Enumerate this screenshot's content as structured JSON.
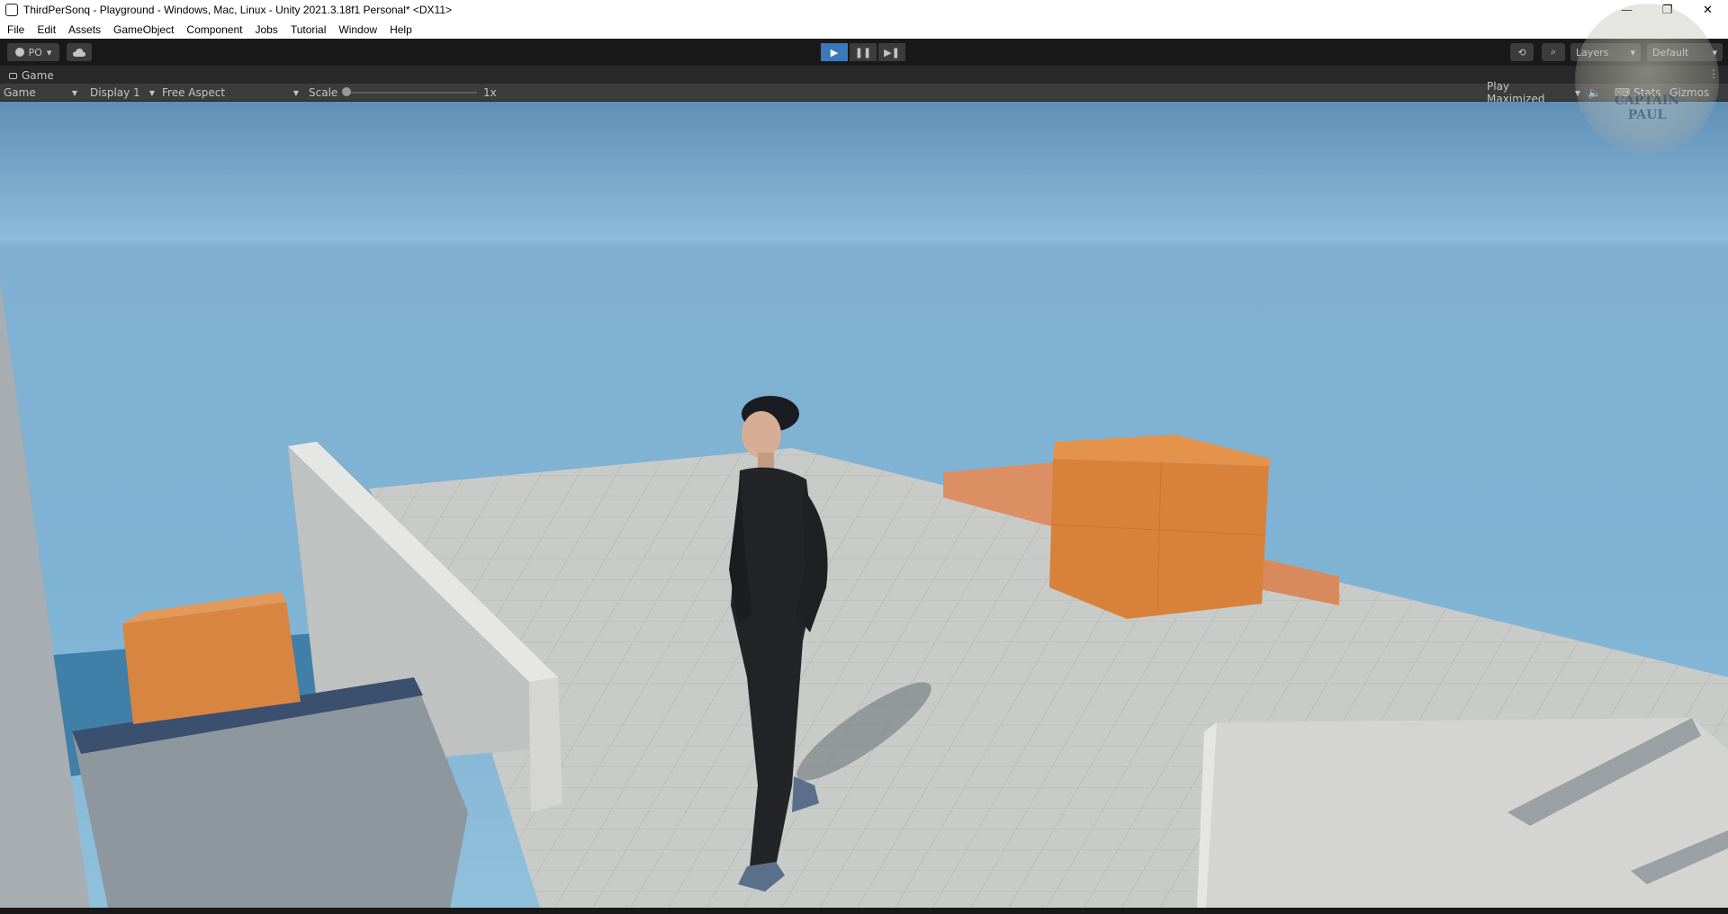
{
  "window": {
    "title": "ThirdPerSonq - Playground - Windows, Mac, Linux - Unity 2021.3.18f1 Personal* <DX11>",
    "minimize_glyph": "—",
    "maximize_glyph": "❐",
    "close_glyph": "✕"
  },
  "menu": {
    "items": [
      {
        "label": "File"
      },
      {
        "label": "Edit"
      },
      {
        "label": "Assets"
      },
      {
        "label": "GameObject"
      },
      {
        "label": "Component"
      },
      {
        "label": "Jobs"
      },
      {
        "label": "Tutorial"
      },
      {
        "label": "Window"
      },
      {
        "label": "Help"
      }
    ]
  },
  "toolbar": {
    "account_label": "PO",
    "play_glyph": "▶",
    "pause_glyph": "❚❚",
    "step_glyph": "▶❚",
    "history_glyph": "⟲",
    "search_glyph": "⌕",
    "layers_label": "Layers",
    "layout_label": "Default",
    "dropdown_glyph": "▾",
    "play_active": true
  },
  "panel": {
    "tab_label": "Game",
    "tab_menu_glyph": "⋮"
  },
  "game_toolbar": {
    "view_mode": "Game",
    "display": "Display 1",
    "aspect": "Free Aspect",
    "scale_label": "Scale",
    "scale_value": "1x",
    "play_mode": "Play Maximized",
    "mute_glyph": "🔈",
    "stats_label": "Stats",
    "gizmos_label": "Gizmos"
  },
  "watermark": {
    "text": "CAPTAIN\nPAUL"
  },
  "colors": {
    "play_active": "#3a79bb",
    "editor_bg": "#191919",
    "toolbar_bg": "#3c3c3c",
    "sky_top": "#5f8fb6",
    "sky_horizon": "#8cbcdb",
    "floor": "#c9cbc8",
    "crate": "#d8813a"
  },
  "scene": {
    "icons": [
      "character-figure",
      "orange-crate",
      "grey-floor-platform"
    ]
  }
}
